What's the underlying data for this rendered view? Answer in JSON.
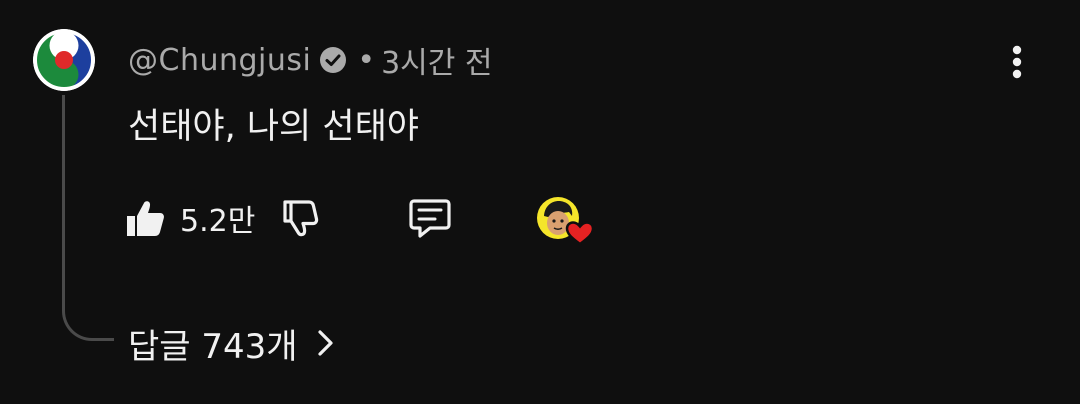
{
  "comment": {
    "handle": "@Chungjusi",
    "separator": "•",
    "time_ago": "3시간 전",
    "text": "선태야, 나의 선태야",
    "like_count": "5.2만",
    "replies_label": "답글 743개"
  },
  "icons": {
    "avatar": "taegeuk-logo-avatar",
    "verified": "verified-check-icon",
    "menu": "more-vertical-icon",
    "like": "thumbs-up-icon",
    "dislike": "thumbs-down-icon",
    "reply": "comment-bubble-icon",
    "creator_heart": "creator-heart-badge",
    "chevron": "chevron-right-icon"
  },
  "colors": {
    "background": "#0f0f0f",
    "primary_text": "#f1f1f1",
    "secondary_text": "#aaaaaa",
    "heart": "#e52222"
  }
}
